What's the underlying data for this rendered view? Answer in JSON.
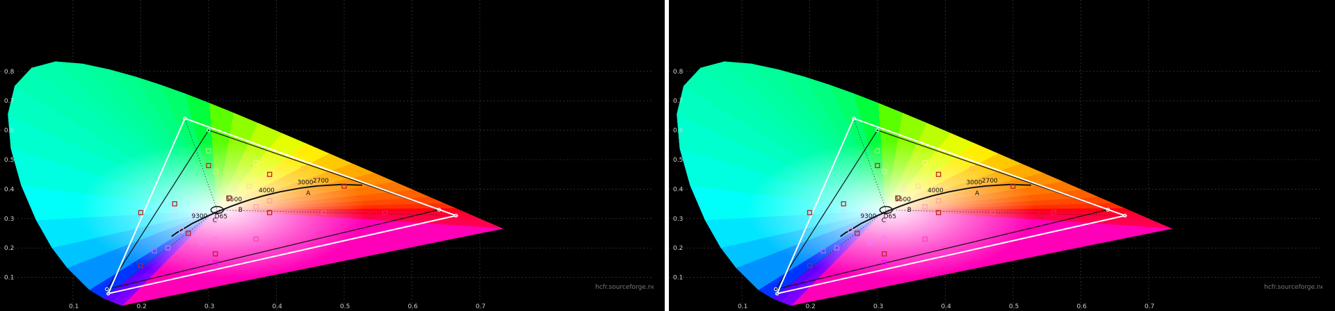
{
  "chart_data": [
    {
      "type": "scatter",
      "title": "",
      "xlabel": "",
      "ylabel": "",
      "xlim": [
        0,
        0.8
      ],
      "ylim": [
        0,
        0.85
      ],
      "x_ticks": [
        "0.1",
        "0.2",
        "0.3",
        "0.4",
        "0.5",
        "0.6",
        "0.7"
      ],
      "y_ticks": [
        "0.1",
        "0.2",
        "0.3",
        "0.4",
        "0.5",
        "0.6",
        "0.7",
        "0.8"
      ],
      "grid": true,
      "planckian_labels": [
        {
          "label": "2700",
          "x": 0.46,
          "y": 0.41
        },
        {
          "label": "3000",
          "x": 0.437,
          "y": 0.404
        },
        {
          "label": "4000",
          "x": 0.38,
          "y": 0.377
        },
        {
          "label": "5500",
          "x": 0.332,
          "y": 0.347
        },
        {
          "label": "9300",
          "x": 0.281,
          "y": 0.29
        }
      ],
      "illuminant_labels": [
        {
          "label": "A",
          "x": 0.448,
          "y": 0.408
        },
        {
          "label": "B",
          "x": 0.348,
          "y": 0.352
        },
        {
          "label": "C",
          "x": 0.31,
          "y": 0.316
        },
        {
          "label": "D65",
          "x": 0.313,
          "y": 0.329
        }
      ],
      "series": [
        {
          "values": [
            [
              0.64,
              0.33
            ],
            [
              0.3,
              0.6
            ],
            [
              0.15,
              0.06
            ]
          ]
        },
        {
          "values": [
            [
              0.665,
              0.31
            ],
            [
              0.265,
              0.64
            ],
            [
              0.152,
              0.045
            ]
          ]
        }
      ],
      "patches": [
        [
          0.2,
          0.32
        ],
        [
          0.25,
          0.32
        ],
        [
          0.28,
          0.32
        ],
        [
          0.25,
          0.35
        ],
        [
          0.3,
          0.53
        ],
        [
          0.31,
          0.46
        ],
        [
          0.3,
          0.48
        ],
        [
          0.34,
          0.4
        ],
        [
          0.36,
          0.41
        ],
        [
          0.33,
          0.37
        ],
        [
          0.37,
          0.34
        ],
        [
          0.39,
          0.36
        ],
        [
          0.39,
          0.32
        ],
        [
          0.45,
          0.31
        ],
        [
          0.47,
          0.32
        ],
        [
          0.54,
          0.31
        ],
        [
          0.56,
          0.32
        ],
        [
          0.37,
          0.49
        ],
        [
          0.39,
          0.45
        ],
        [
          0.44,
          0.47
        ],
        [
          0.46,
          0.43
        ],
        [
          0.5,
          0.41
        ],
        [
          0.31,
          0.29
        ],
        [
          0.31,
          0.23
        ],
        [
          0.31,
          0.18
        ],
        [
          0.31,
          0.15
        ],
        [
          0.29,
          0.22
        ],
        [
          0.27,
          0.25
        ],
        [
          0.24,
          0.2
        ],
        [
          0.22,
          0.19
        ],
        [
          0.2,
          0.14
        ],
        [
          0.37,
          0.23
        ],
        [
          0.26,
          0.26
        ]
      ],
      "watermark": "hcfr.sourceforge.net"
    },
    {
      "type": "scatter",
      "title": "",
      "xlabel": "",
      "ylabel": "",
      "xlim": [
        0,
        0.8
      ],
      "ylim": [
        0,
        0.85
      ],
      "x_ticks": [
        "0.1",
        "0.2",
        "0.3",
        "0.4",
        "0.5",
        "0.6",
        "0.7"
      ],
      "y_ticks": [
        "0.1",
        "0.2",
        "0.3",
        "0.4",
        "0.5",
        "0.6",
        "0.7",
        "0.8"
      ],
      "grid": true,
      "planckian_labels": [
        {
          "label": "2700",
          "x": 0.46,
          "y": 0.41
        },
        {
          "label": "3000",
          "x": 0.437,
          "y": 0.404
        },
        {
          "label": "4000",
          "x": 0.38,
          "y": 0.377
        },
        {
          "label": "5500",
          "x": 0.332,
          "y": 0.347
        },
        {
          "label": "9300",
          "x": 0.281,
          "y": 0.29
        }
      ],
      "illuminant_labels": [
        {
          "label": "A",
          "x": 0.448,
          "y": 0.408
        },
        {
          "label": "B",
          "x": 0.348,
          "y": 0.352
        },
        {
          "label": "C",
          "x": 0.31,
          "y": 0.316
        },
        {
          "label": "D65",
          "x": 0.313,
          "y": 0.329
        }
      ],
      "series": [
        {
          "values": [
            [
              0.64,
              0.33
            ],
            [
              0.3,
              0.6
            ],
            [
              0.15,
              0.06
            ]
          ]
        },
        {
          "values": [
            [
              0.665,
              0.31
            ],
            [
              0.265,
              0.64
            ],
            [
              0.152,
              0.045
            ]
          ]
        }
      ],
      "patches": [
        [
          0.2,
          0.32
        ],
        [
          0.25,
          0.32
        ],
        [
          0.28,
          0.32
        ],
        [
          0.25,
          0.35
        ],
        [
          0.3,
          0.53
        ],
        [
          0.31,
          0.46
        ],
        [
          0.3,
          0.48
        ],
        [
          0.34,
          0.4
        ],
        [
          0.36,
          0.41
        ],
        [
          0.33,
          0.37
        ],
        [
          0.37,
          0.34
        ],
        [
          0.39,
          0.36
        ],
        [
          0.39,
          0.32
        ],
        [
          0.45,
          0.31
        ],
        [
          0.47,
          0.32
        ],
        [
          0.54,
          0.31
        ],
        [
          0.56,
          0.32
        ],
        [
          0.37,
          0.49
        ],
        [
          0.39,
          0.45
        ],
        [
          0.44,
          0.47
        ],
        [
          0.46,
          0.43
        ],
        [
          0.5,
          0.41
        ],
        [
          0.31,
          0.29
        ],
        [
          0.31,
          0.23
        ],
        [
          0.31,
          0.18
        ],
        [
          0.31,
          0.15
        ],
        [
          0.29,
          0.22
        ],
        [
          0.27,
          0.25
        ],
        [
          0.24,
          0.2
        ],
        [
          0.22,
          0.19
        ],
        [
          0.2,
          0.14
        ],
        [
          0.37,
          0.23
        ],
        [
          0.26,
          0.26
        ]
      ],
      "watermark": "hcfr.sourceforge.net"
    }
  ],
  "colors": {
    "background": "#000000",
    "grid": "#4a4a4a",
    "reference_gamut": "#111111",
    "measured_gamut": "#ffffff",
    "planckian": "#111111",
    "divider": "#ffffff"
  }
}
